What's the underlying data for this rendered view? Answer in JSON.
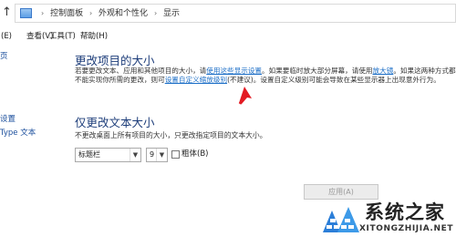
{
  "address_bar": {
    "up_icon": "up-arrow-icon",
    "breadcrumbs": [
      "控制面板",
      "外观和个性化",
      "显示"
    ]
  },
  "menu": {
    "file": "(E)",
    "view": "查看(V)",
    "tools": "工具(T)",
    "help": "帮助(H)"
  },
  "nav": {
    "item1": "页",
    "item2": "设置",
    "item3": "Type 文本"
  },
  "section1": {
    "title": "更改项目的大小",
    "text1": "若要更改文本、应用和其他项目的大小，请",
    "link1": "使用这些显示设置",
    "text2": "。如果要临时放大部分屏幕，请使用",
    "link2": "放大镜",
    "text3": "。如果这两种方式都不能实现你所需的更改，则可",
    "link3": "设置自定义缩放级别",
    "text4": "(不建议)。设置自定义级别可能会导致在某些显示器上出现意外行为。"
  },
  "section2": {
    "title": "仅更改文本大小",
    "description": "不更改桌面上所有项目的大小，只更改指定项目的文本大小。",
    "item_select": "标题栏",
    "size_select": "9",
    "bold_label": "粗体(B)"
  },
  "apply_button": "应用(A)",
  "watermark": {
    "main": "系统之家",
    "sub": "XITONGZHIJIA.NET"
  },
  "colors": {
    "heading": "#1d3d7a",
    "link": "#1d6fc7",
    "arrow": "#e31b23"
  }
}
